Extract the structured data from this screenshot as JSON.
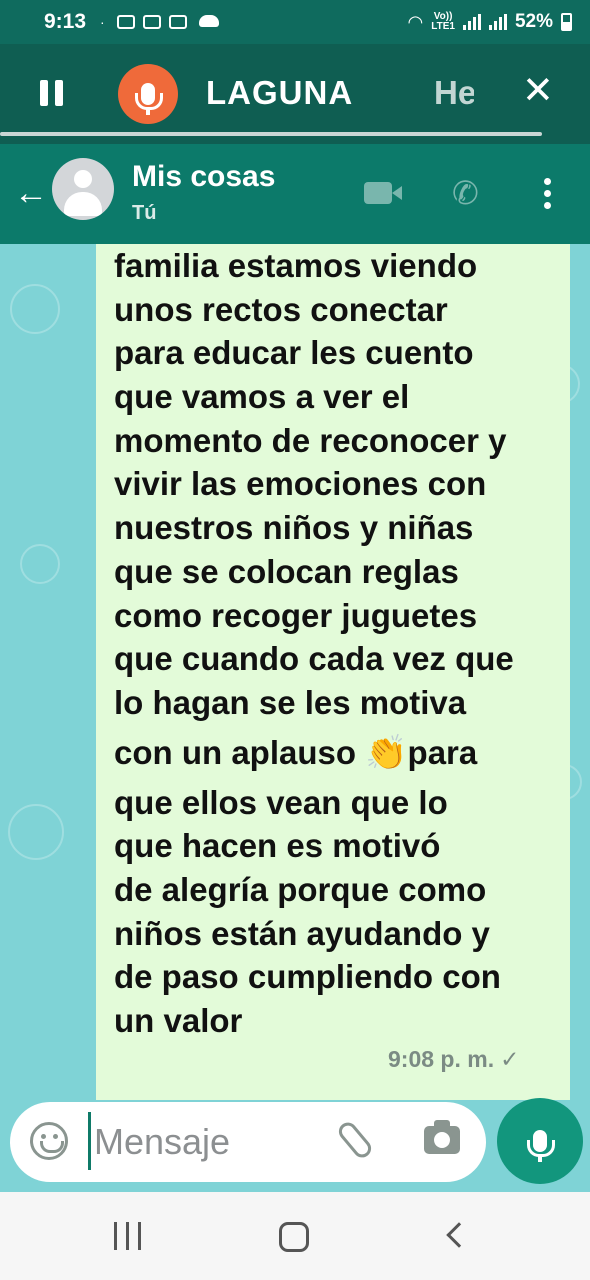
{
  "status_bar": {
    "time": "9:13",
    "volte_line1": "Vo))",
    "volte_line2": "LTE1",
    "battery": "52%"
  },
  "recording_bar": {
    "title": "LAGUNA",
    "next_partial": "He",
    "close_symbol": "✕"
  },
  "chat_header": {
    "name": "Mis cosas",
    "subtitle": "Tú"
  },
  "message": {
    "lines": [
      "familia  estamos viendo",
      "unos rectos conectar",
      "para educar  les cuento",
      "que  vamos a ver el",
      "momento de reconocer y",
      "vivir las emociones  con",
      "nuestros niños y niñas",
      "que se colocan reglas",
      "como recoger  juguetes",
      "que cuando cada vez que",
      "lo hagan se les motiva",
      "con un aplauso ",
      "que ellos vean que lo",
      "que hacen es motivó",
      "de alegría porque como",
      "niños están ayudando  y",
      "de paso cumpliendo con",
      "un valor"
    ],
    "emoji": "👏",
    "after_emoji": "para",
    "time": "9:08 p. m.",
    "check": "✓"
  },
  "input": {
    "placeholder": "Mensaje"
  },
  "colors": {
    "header_green": "#0c7a6a",
    "accent_orange": "#ef6a3a",
    "bubble": "#e3fbd9",
    "chat_bg": "#7fd3d6",
    "send_button": "#12967d"
  },
  "icons": {
    "back": "arrow-left-icon",
    "video": "video-camera-icon",
    "phone": "phone-icon",
    "menu": "more-vert-icon",
    "emoji": "emoji-icon",
    "attach": "paperclip-icon",
    "camera": "camera-icon",
    "mic": "microphone-icon"
  }
}
